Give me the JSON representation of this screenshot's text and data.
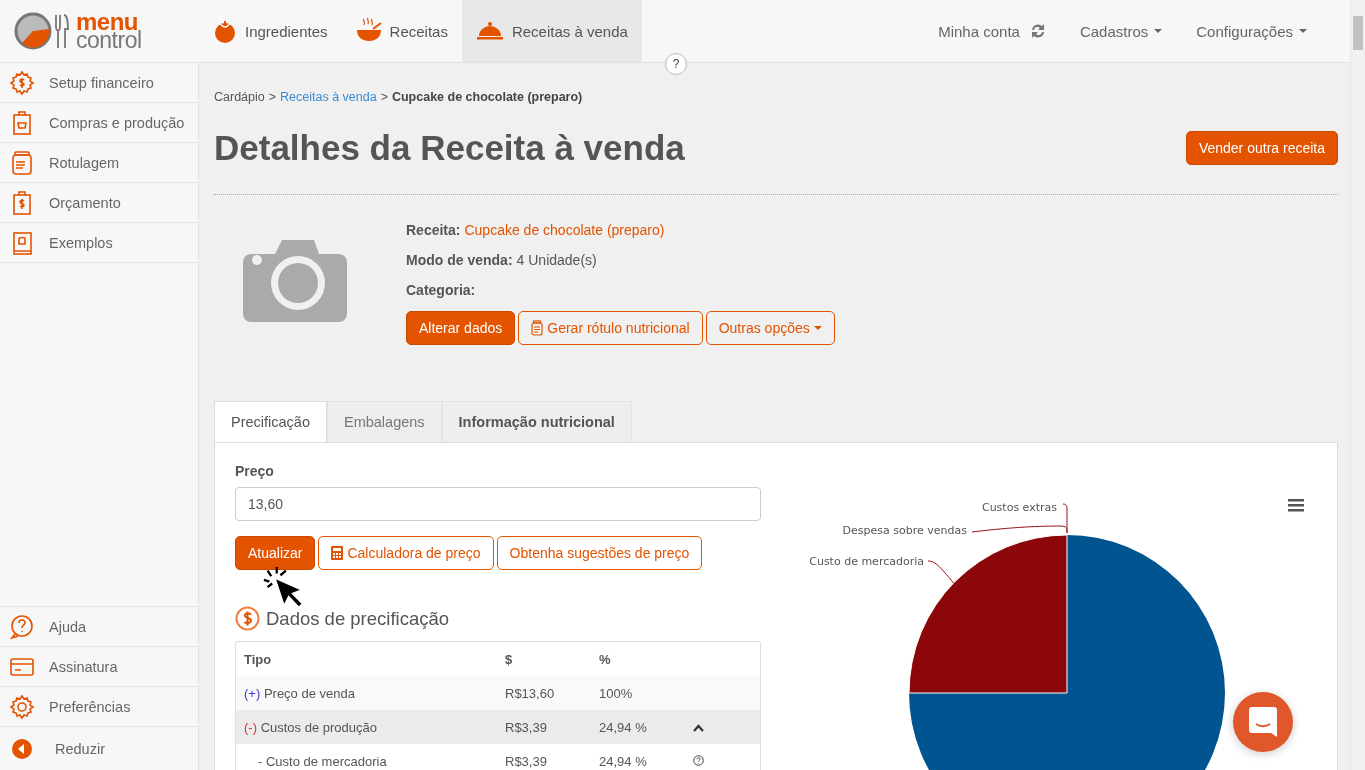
{
  "logo": {
    "top": "menu",
    "bottom": "control"
  },
  "nav": [
    {
      "label": "Ingredientes",
      "selected": false
    },
    {
      "label": "Receitas",
      "selected": false
    },
    {
      "label": "Receitas à venda",
      "selected": true
    }
  ],
  "account_menu": [
    {
      "label": "Minha conta",
      "kind": "sync"
    },
    {
      "label": "Cadastros",
      "kind": "dropdown"
    },
    {
      "label": "Configurações",
      "kind": "dropdown"
    }
  ],
  "help_button": "?",
  "sidebar": {
    "items": [
      {
        "label": "Setup financeiro"
      },
      {
        "label": "Compras e produção"
      },
      {
        "label": "Rotulagem"
      },
      {
        "label": "Orçamento"
      },
      {
        "label": "Exemplos"
      }
    ],
    "bottom_items": [
      {
        "label": "Ajuda"
      },
      {
        "label": "Assinatura"
      },
      {
        "label": "Preferências"
      },
      {
        "label": "Reduzir"
      }
    ]
  },
  "breadcrumb": [
    {
      "label": "Cardápio",
      "kind": "text"
    },
    {
      "label": ">",
      "kind": "separator"
    },
    {
      "label": "Receitas à venda",
      "kind": "link"
    },
    {
      "label": ">",
      "kind": "separator"
    },
    {
      "label": "Cupcake de chocolate (preparo)",
      "kind": "current"
    }
  ],
  "title": "Detalhes da Receita à venda",
  "title_action": "Vender outra receita",
  "recipe": {
    "fields": [
      {
        "label": "Receita:",
        "value": "Cupcake de chocolate (preparo)",
        "kind": "link"
      },
      {
        "label": "Modo de venda:",
        "value": "4 Unidade(s)",
        "kind": "text"
      },
      {
        "label": "Categoria:"
      }
    ],
    "buttons": [
      {
        "label": "Alterar dados",
        "kind": "primary"
      },
      {
        "label": "Gerar rótulo nutricional",
        "kind": "label"
      },
      {
        "label": "Outras opções",
        "kind": "dropdown"
      }
    ]
  },
  "tabs": [
    {
      "label": "Precificação",
      "selected": true,
      "bold": false
    },
    {
      "label": "Embalagens",
      "selected": false,
      "bold": false
    },
    {
      "label": "Informação nutricional",
      "selected": false,
      "bold": true
    }
  ],
  "pricing": {
    "price_label": "Preço",
    "price_value": "13,60",
    "buttons": [
      {
        "label": "Atualizar",
        "kind": "primary"
      },
      {
        "label": "Calculadora de preço",
        "kind": "calculator"
      },
      {
        "label": "Obtenha sugestões de preço",
        "kind": "plain"
      }
    ],
    "section_title": "Dados de precificação",
    "table": {
      "columns": [
        "Tipo",
        "$",
        "%"
      ],
      "rows": [
        {
          "kind": "income",
          "sign": "(+)",
          "type": "Preço de venda",
          "amount": "R$13,60",
          "percent": "100%"
        },
        {
          "kind": "cost",
          "sign": "(-)",
          "type": "Custos de produção",
          "amount": "R$3,39",
          "percent": "24,94 %",
          "expanded": true
        },
        {
          "kind": "detail",
          "type": "- Custo de mercadoria",
          "amount": "R$3,39",
          "percent": "24,94 %"
        }
      ]
    }
  },
  "chart": {
    "slice_labels": [
      "Custos extras",
      "Despesa sobre vendas",
      "Custo de mercadoria"
    ]
  }
}
